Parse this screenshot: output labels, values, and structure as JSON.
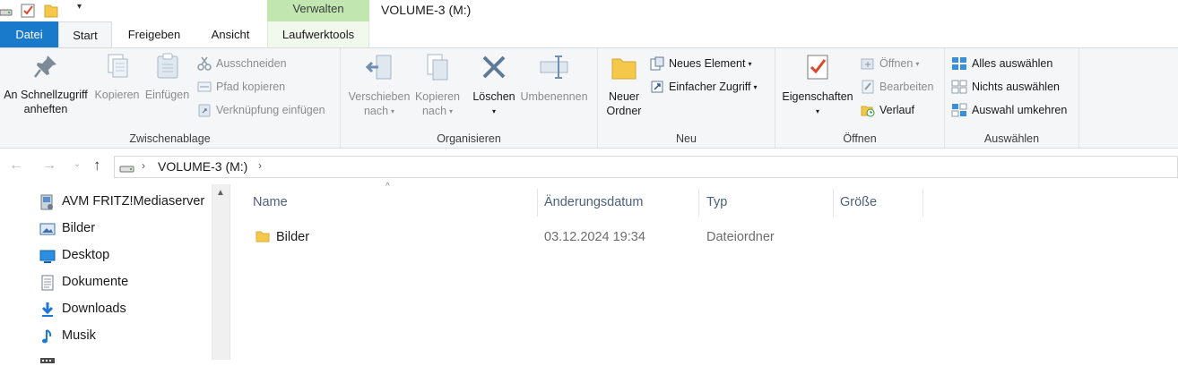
{
  "window": {
    "title": "VOLUME-3 (M:)",
    "context_tab_header": "Verwalten"
  },
  "tabs": {
    "datei": "Datei",
    "start": "Start",
    "freigeben": "Freigeben",
    "ansicht": "Ansicht",
    "laufwerktools": "Laufwerktools"
  },
  "ribbon": {
    "clipboard": {
      "label": "Zwischenablage",
      "pin_line1": "An Schnellzugriff",
      "pin_line2": "anheften",
      "copy": "Kopieren",
      "paste": "Einfügen",
      "cut": "Ausschneiden",
      "copy_path": "Pfad kopieren",
      "paste_shortcut": "Verknüpfung einfügen"
    },
    "organize": {
      "label": "Organisieren",
      "move_line1": "Verschieben",
      "move_line2": "nach",
      "copyto_line1": "Kopieren",
      "copyto_line2": "nach",
      "delete": "Löschen",
      "rename": "Umbenennen"
    },
    "new": {
      "label": "Neu",
      "folder_line1": "Neuer",
      "folder_line2": "Ordner",
      "new_item": "Neues Element",
      "easy_access": "Einfacher Zugriff"
    },
    "open": {
      "label": "Öffnen",
      "properties": "Eigenschaften",
      "open": "Öffnen",
      "edit": "Bearbeiten",
      "history": "Verlauf"
    },
    "select": {
      "label": "Auswählen",
      "select_all": "Alles auswählen",
      "select_none": "Nichts auswählen",
      "invert": "Auswahl umkehren"
    }
  },
  "address": {
    "crumb": "VOLUME-3 (M:)"
  },
  "navpane": {
    "items": [
      {
        "label": "AVM FRITZ!Mediaserver",
        "icon": "media-server-icon"
      },
      {
        "label": "Bilder",
        "icon": "pictures-icon"
      },
      {
        "label": "Desktop",
        "icon": "desktop-icon"
      },
      {
        "label": "Dokumente",
        "icon": "documents-icon"
      },
      {
        "label": "Downloads",
        "icon": "downloads-icon"
      },
      {
        "label": "Musik",
        "icon": "music-icon"
      }
    ]
  },
  "filelist": {
    "columns": [
      "Name",
      "Änderungsdatum",
      "Typ",
      "Größe"
    ],
    "rows": [
      {
        "name": "Bilder",
        "date": "03.12.2024 19:34",
        "type": "Dateiordner",
        "size": ""
      }
    ]
  },
  "colors": {
    "datei_tab": "#1979ca",
    "context_green": "#c1e6b0",
    "ribbon_bg": "#f5f6f7",
    "column_header_text": "#4c607a"
  }
}
